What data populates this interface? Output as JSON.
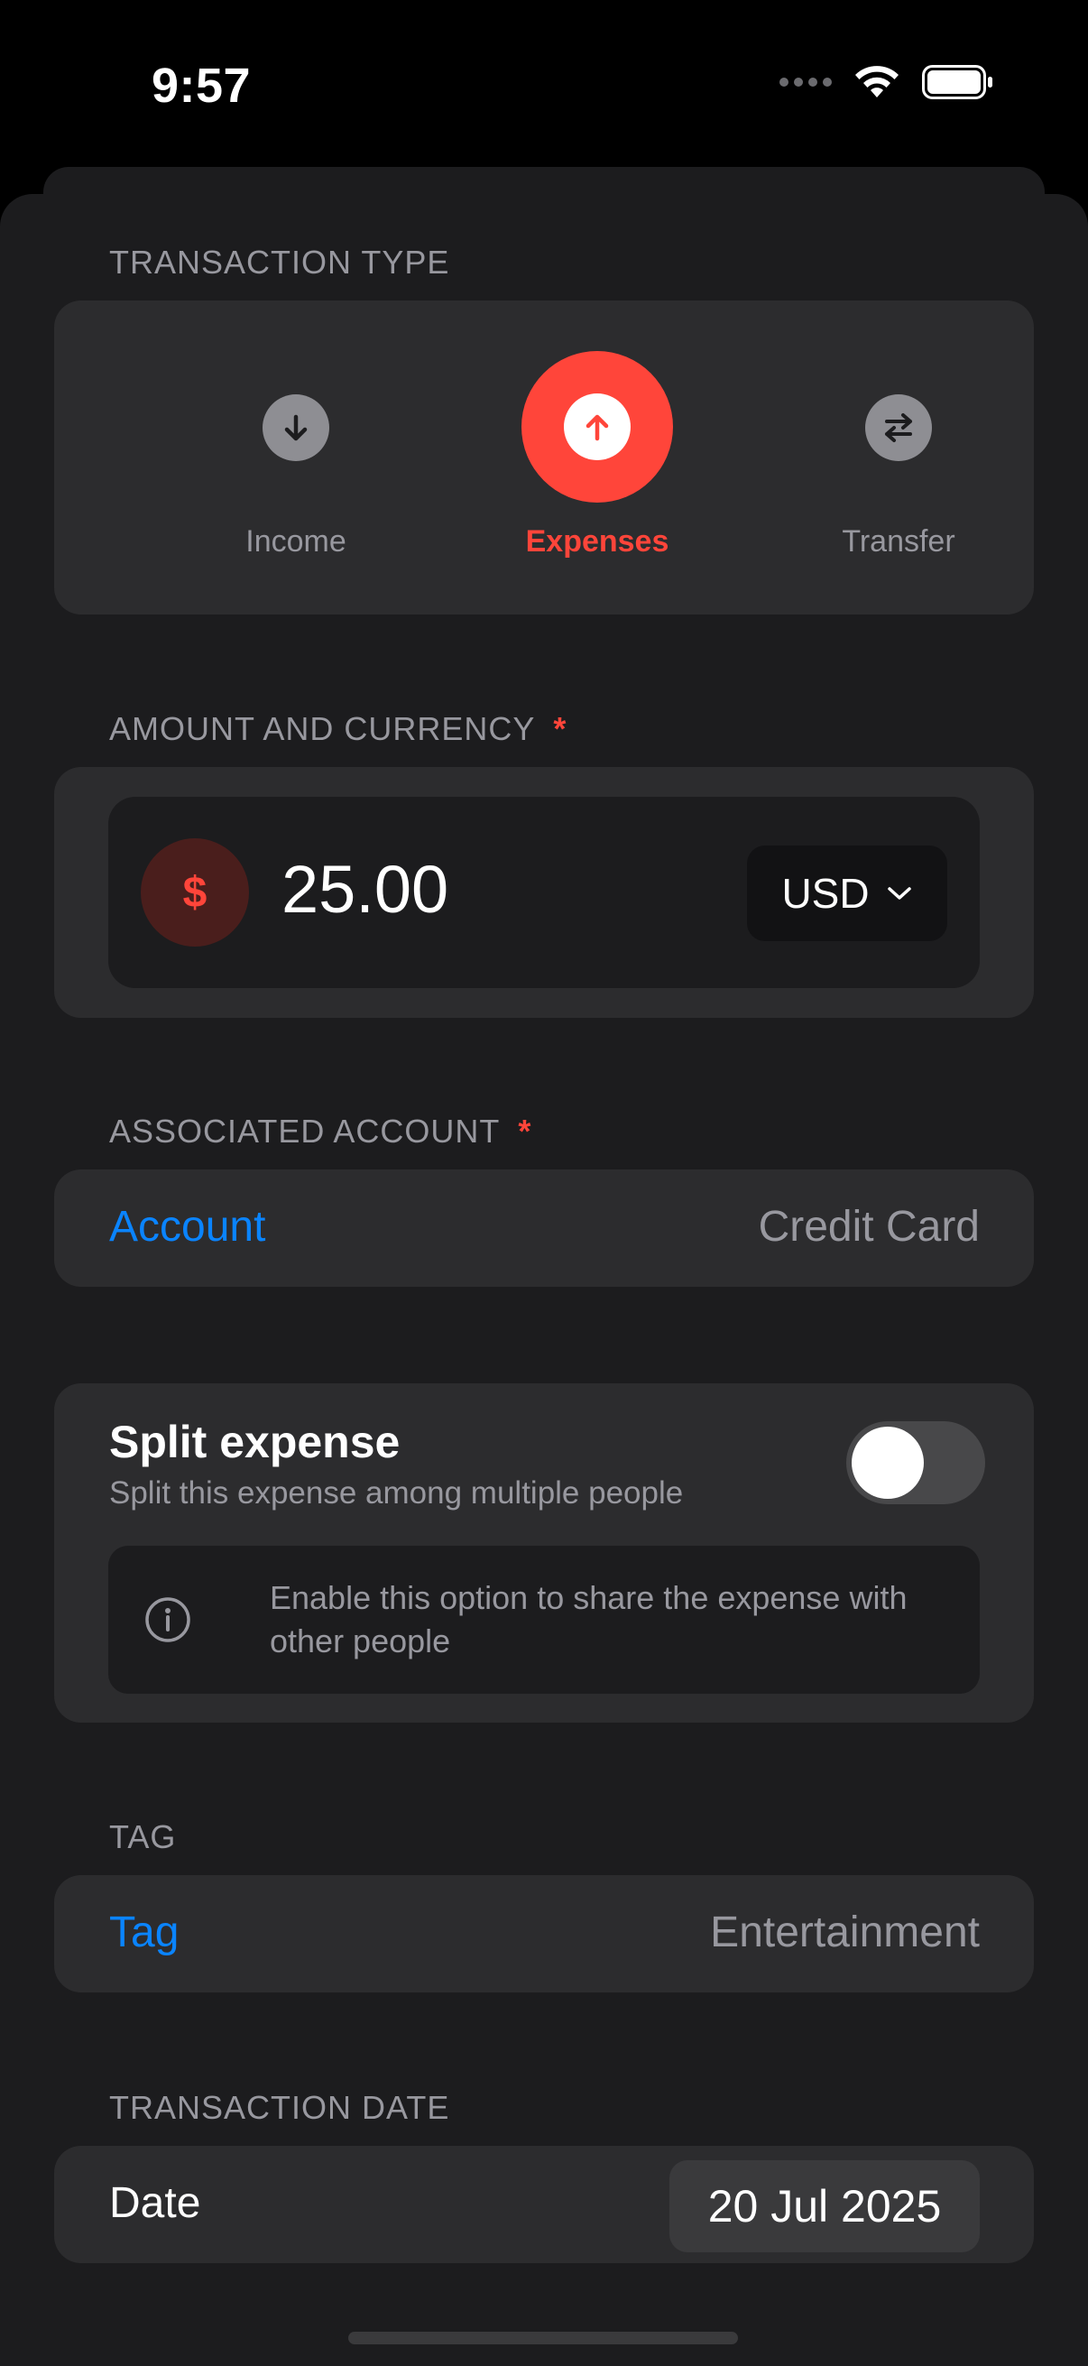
{
  "status": {
    "time": "9:57"
  },
  "transaction_type": {
    "section_label": "TRANSACTION TYPE",
    "options": [
      {
        "label": "Income",
        "icon": "arrow-down-icon",
        "selected": false
      },
      {
        "label": "Expenses",
        "icon": "arrow-up-icon",
        "selected": true
      },
      {
        "label": "Transfer",
        "icon": "swap-arrows-icon",
        "selected": false
      }
    ]
  },
  "amount": {
    "section_label": "AMOUNT AND CURRENCY",
    "required_mark": "*",
    "currency_symbol": "$",
    "value": "25.00",
    "currency": "USD"
  },
  "account": {
    "section_label": "ASSOCIATED ACCOUNT",
    "required_mark": "*",
    "label": "Account",
    "value": "Credit Card"
  },
  "split": {
    "title": "Split expense",
    "subtitle": "Split this expense among multiple people",
    "enabled": false,
    "info": "Enable this option to share the expense with other people"
  },
  "tag": {
    "section_label": "TAG",
    "label": "Tag",
    "value": "Entertainment"
  },
  "date": {
    "section_label": "TRANSACTION DATE",
    "label": "Date",
    "value": "20 Jul 2025"
  },
  "colors": {
    "accent_red": "#ff453a",
    "link_blue": "#0a84ff",
    "background": "#1c1c1e",
    "card": "#2c2c2e"
  }
}
